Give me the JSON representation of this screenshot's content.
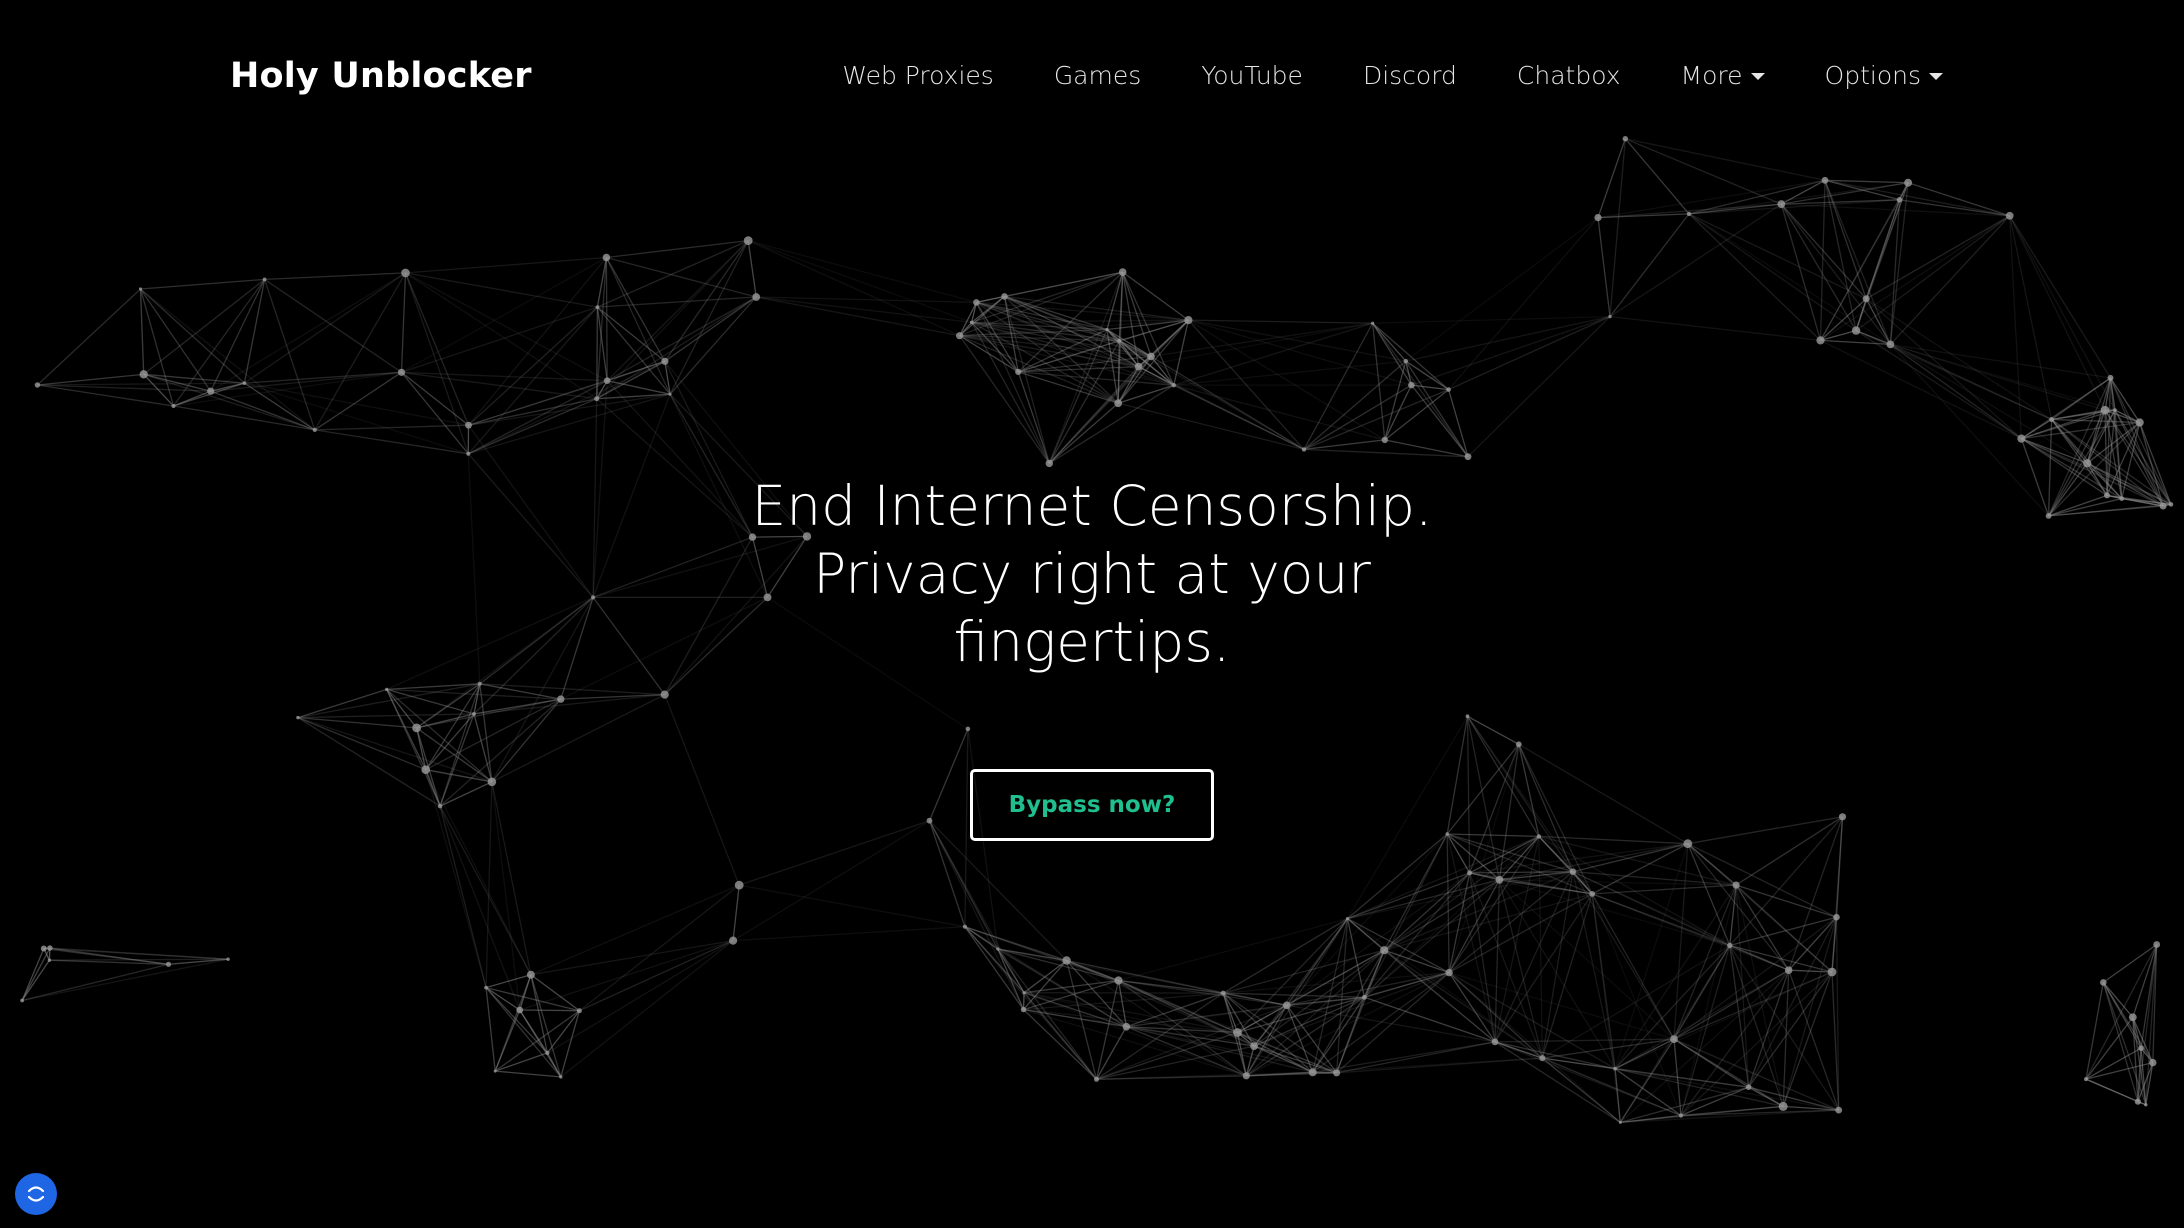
{
  "brand": {
    "name": "Holy Unblocker"
  },
  "nav": {
    "items": [
      {
        "label": "Web Proxies",
        "dropdown": false
      },
      {
        "label": "Games",
        "dropdown": false
      },
      {
        "label": "YouTube",
        "dropdown": false
      },
      {
        "label": "Discord",
        "dropdown": false
      },
      {
        "label": "Chatbox",
        "dropdown": false
      },
      {
        "label": "More",
        "dropdown": true
      },
      {
        "label": "Options",
        "dropdown": true
      }
    ]
  },
  "hero": {
    "title_line1": "End Internet Censorship.",
    "title_line2": "Privacy right at your",
    "title_line3": "fingertips.",
    "button_label": "Bypass now?"
  },
  "colors": {
    "background": "#000000",
    "text": "#ffffff",
    "accent": "#1fbf8f",
    "widget": "#1f66e5",
    "network_line": "#8a8a8a"
  },
  "icons": {
    "widget_icon": "chat-widget-icon"
  }
}
